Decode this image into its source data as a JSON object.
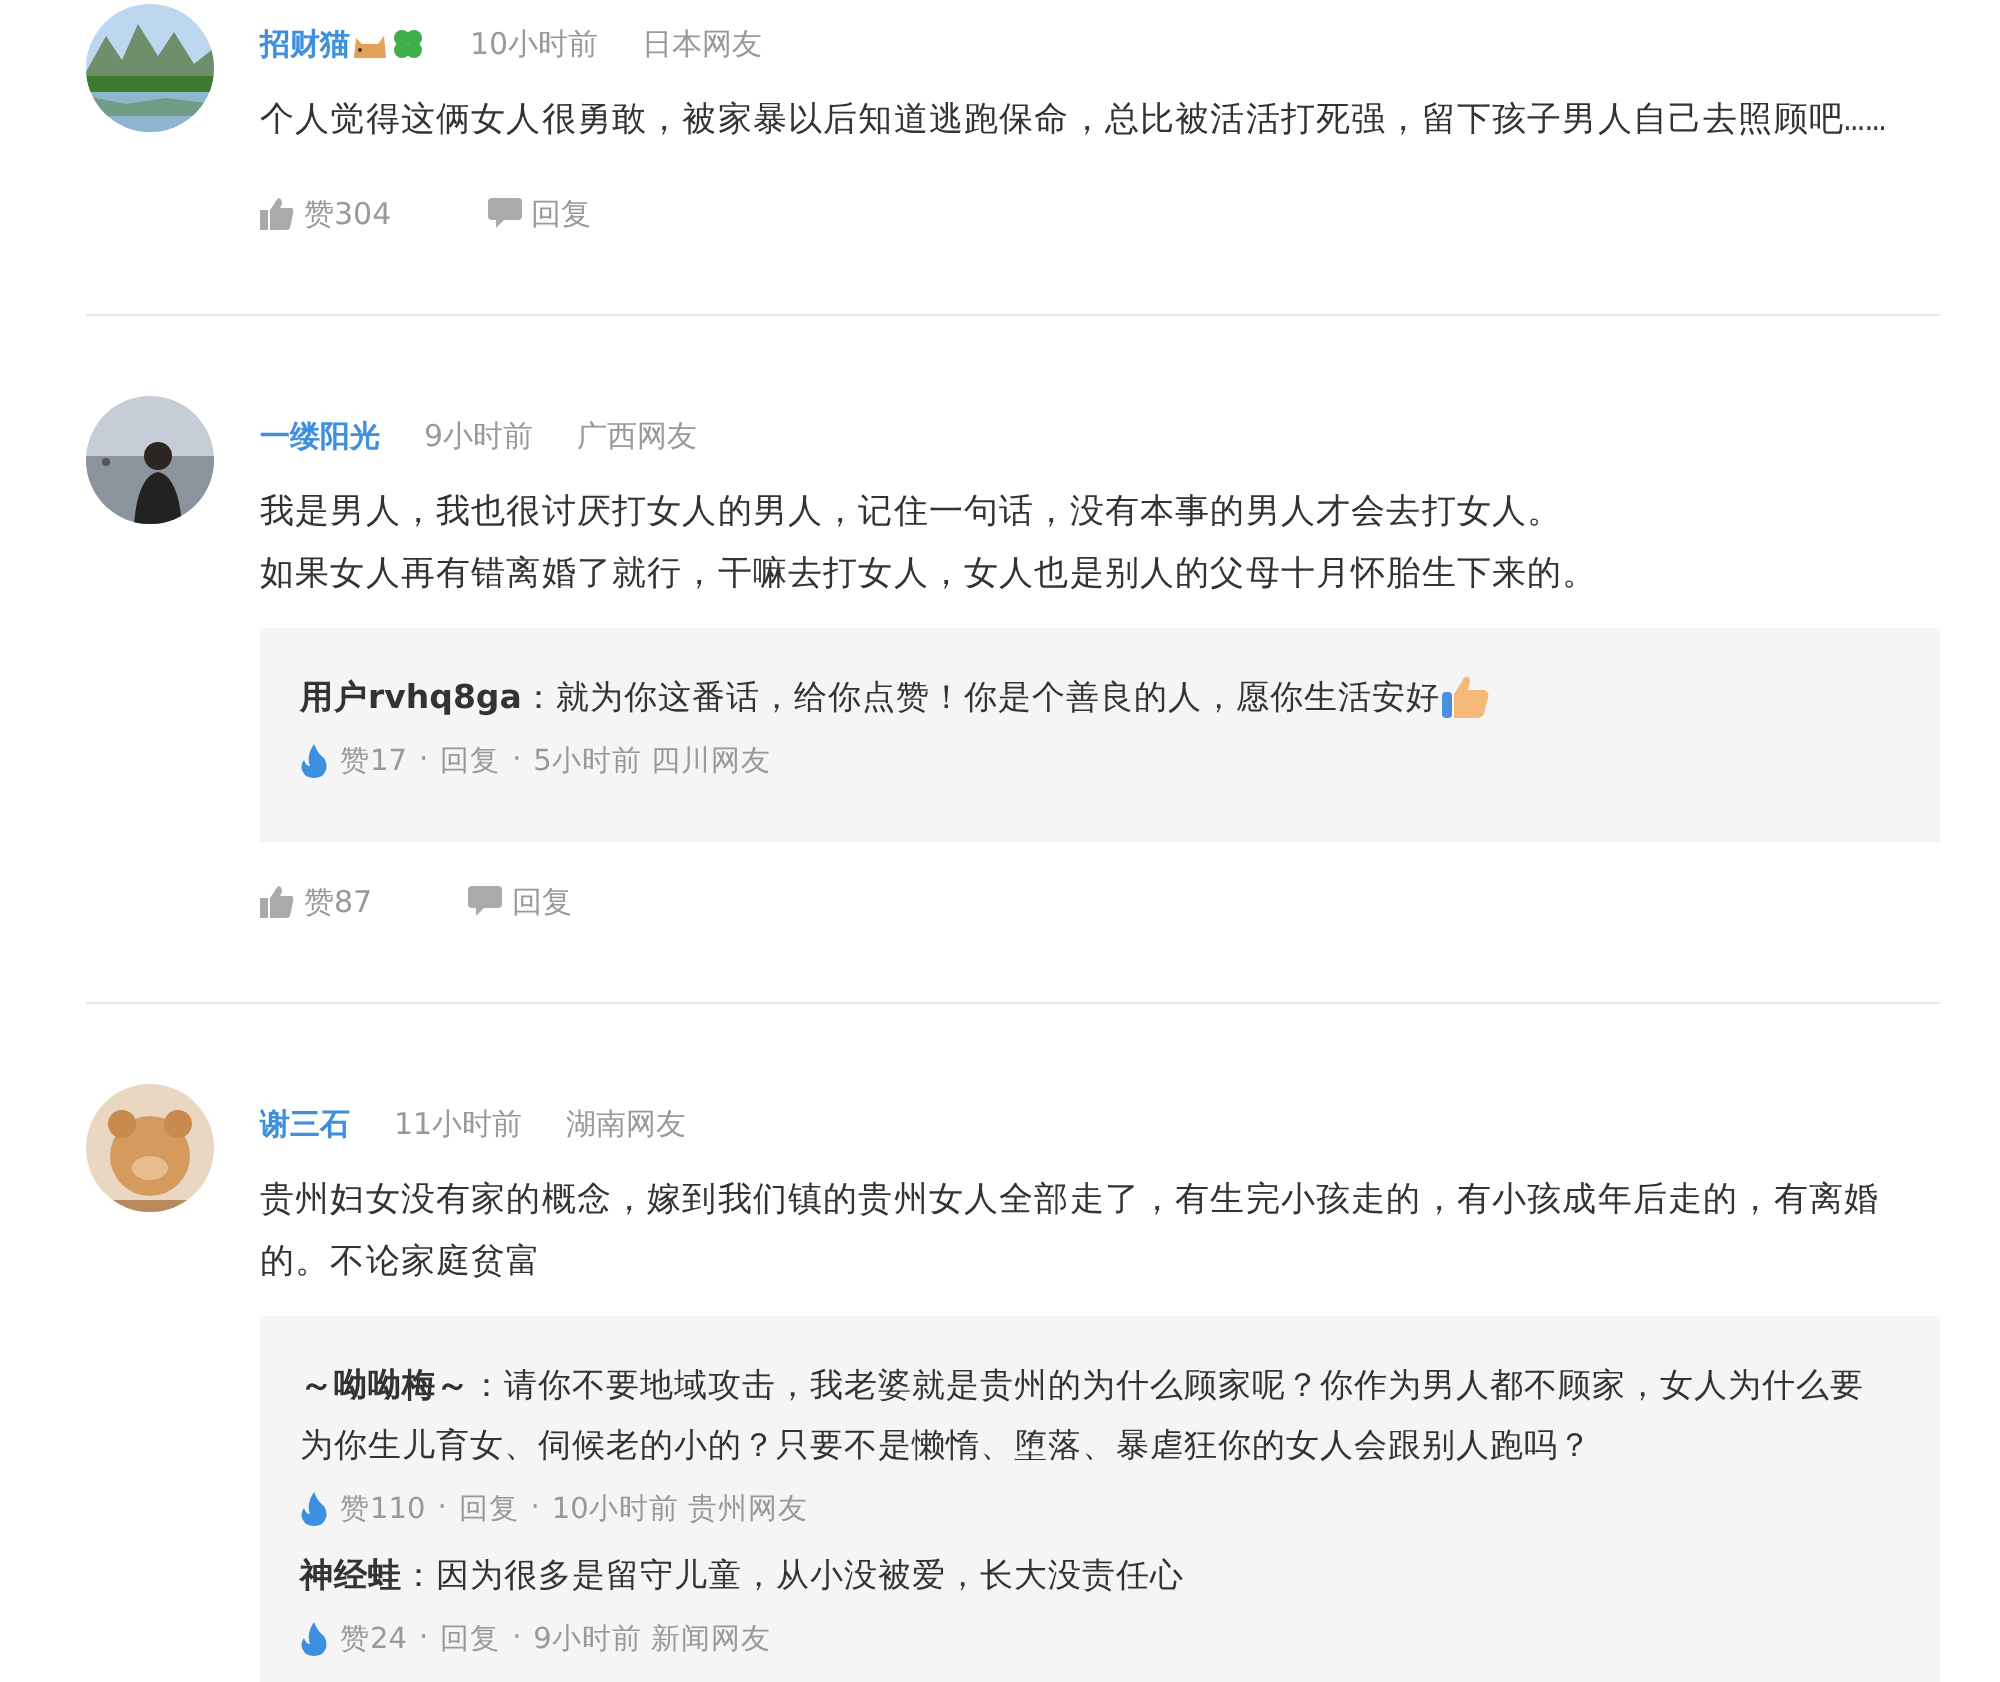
{
  "separator": "·",
  "comments": [
    {
      "user": "招财猫",
      "name_emojis": [
        {
          "kind": "cat"
        },
        {
          "kind": "clover"
        }
      ],
      "time": "10小时前",
      "location": "日本网友",
      "paragraphs": [
        "个人觉得这俩女人很勇敢，被家暴以后知道逃跑保命，总比被活活打死强，留下孩子男人自己去照顾吧……"
      ],
      "likes": "赞304",
      "reply_label": "回复"
    },
    {
      "user": "一缕阳光",
      "time": "9小时前",
      "location": "广西网友",
      "paragraphs": [
        "我是男人，我也很讨厌打女人的男人，记住一句话，没有本事的男人才会去打女人。",
        "如果女人再有错离婚了就行，干嘛去打女人，女人也是别人的父母十月怀胎生下来的。"
      ],
      "replies": [
        {
          "text": "**用户rvhq8ga**：就为你这番话，给你点赞！你是个善良的人，愿你生活安好",
          "emoji": {
            "kind": "thumbs_up"
          },
          "likes": "赞17",
          "reply_label": "回复",
          "info": "5小时前 四川网友"
        }
      ],
      "likes": "赞87",
      "reply_label": "回复"
    },
    {
      "user": "谢三石",
      "time": "11小时前",
      "location": "湖南网友",
      "paragraphs": [
        "贵州妇女没有家的概念，嫁到我们镇的贵州女人全部走了，有生完小孩走的，有小孩成年后走的，有离婚的。不论家庭贫富"
      ],
      "replies": [
        {
          "text": "**～呦呦梅～**：请你不要地域攻击，我老婆就是贵州的为什么顾家呢？你作为男人都不顾家，女人为什么要为你生儿育女、伺候老的小的？只要不是懒惰、堕落、暴虐狂你的女人会跟别人跑吗？",
          "likes": "赞110",
          "reply_label": "回复",
          "info": "10小时前 贵州网友"
        },
        {
          "text": "**神经蛙**：因为很多是留守儿童，从小没被爱，长大没责任心",
          "likes": "赞24",
          "reply_label": "回复",
          "info": "9小时前 新闻网友"
        }
      ]
    }
  ]
}
